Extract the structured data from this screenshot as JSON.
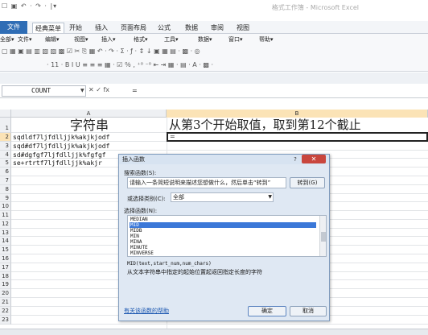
{
  "window": {
    "qat": "☐ ▣ ↶ · ↷ · |▾",
    "title": "格式工作簿 - Microsoft Excel"
  },
  "ribbon_tabs": [
    "文件",
    "经典菜单",
    "开始",
    "插入",
    "页面布局",
    "公式",
    "数据",
    "审阅",
    "视图"
  ],
  "menu_row": [
    "全部▾",
    "文件▾",
    "编辑▾",
    "视图▾",
    "插入▾",
    "格式▾",
    "工具▾",
    "数据▾",
    "窗口▾",
    "帮助▾"
  ],
  "toolbar1": "▢ ▦ ▣ ▤ ▥ ▧ ▨ ▩ ☑ ✂ ⎘ ▦ ↶ · ↷ · Σ · ƒ · ↕ ↓ ▣ ▦ ▤ · ▩ · ◎",
  "toolbar2": "· 11 · B I U  ≡ ≡ ≡ ▦ · ☑ ％ ,  ⁺⁰ ⁻⁰  ⇤ ⇥ ▦ · ▤ · A · ▩ ·",
  "formula_bar": {
    "name_box": "COUNT",
    "buttons": "✕ ✓ fx",
    "content": "="
  },
  "grid": {
    "columns": [
      "A",
      "B"
    ],
    "row_numbers": [
      "1",
      "2",
      "3",
      "4",
      "5",
      "6",
      "7",
      "8",
      "9",
      "10",
      "11",
      "12",
      "13",
      "14",
      "15",
      "16",
      "17",
      "18",
      "19",
      "20",
      "21",
      "22",
      "23"
    ],
    "header_A": "字符串",
    "header_B": "从第3个开始取值，取到第12个截止",
    "cells_A": [
      "sqdldf7ljfdlljjk%akjkjodf",
      "sqd#df7ljfdlljjk%akjkjodf",
      "sd#dgfgf7ljfdlljjk%fgfgf",
      "se+rtrtf7ljfdlljjk%akjr"
    ],
    "cell_B2": "="
  },
  "dialog": {
    "title": "插入函数",
    "help": "?",
    "close": "✕",
    "search_label": "搜索函数(S):",
    "search_value": "请输入一条简短说明来描述您想做什么，然后单击“转到”",
    "go_button": "转到(G)",
    "category_label": "或选择类别(C):",
    "category_value": "全部",
    "function_label": "选择函数(N):",
    "functions": [
      "MEDIAN",
      "MID",
      "MIDB",
      "MIN",
      "MINA",
      "MINUTE",
      "MINVERSE"
    ],
    "selected_function": "MID",
    "signature": "MID(text,start_num,num_chars)",
    "description": "从文本字符串中指定的起始位置起返回指定长度的字符",
    "help_link": "有关该函数的帮助",
    "ok": "确定",
    "cancel": "取消"
  }
}
